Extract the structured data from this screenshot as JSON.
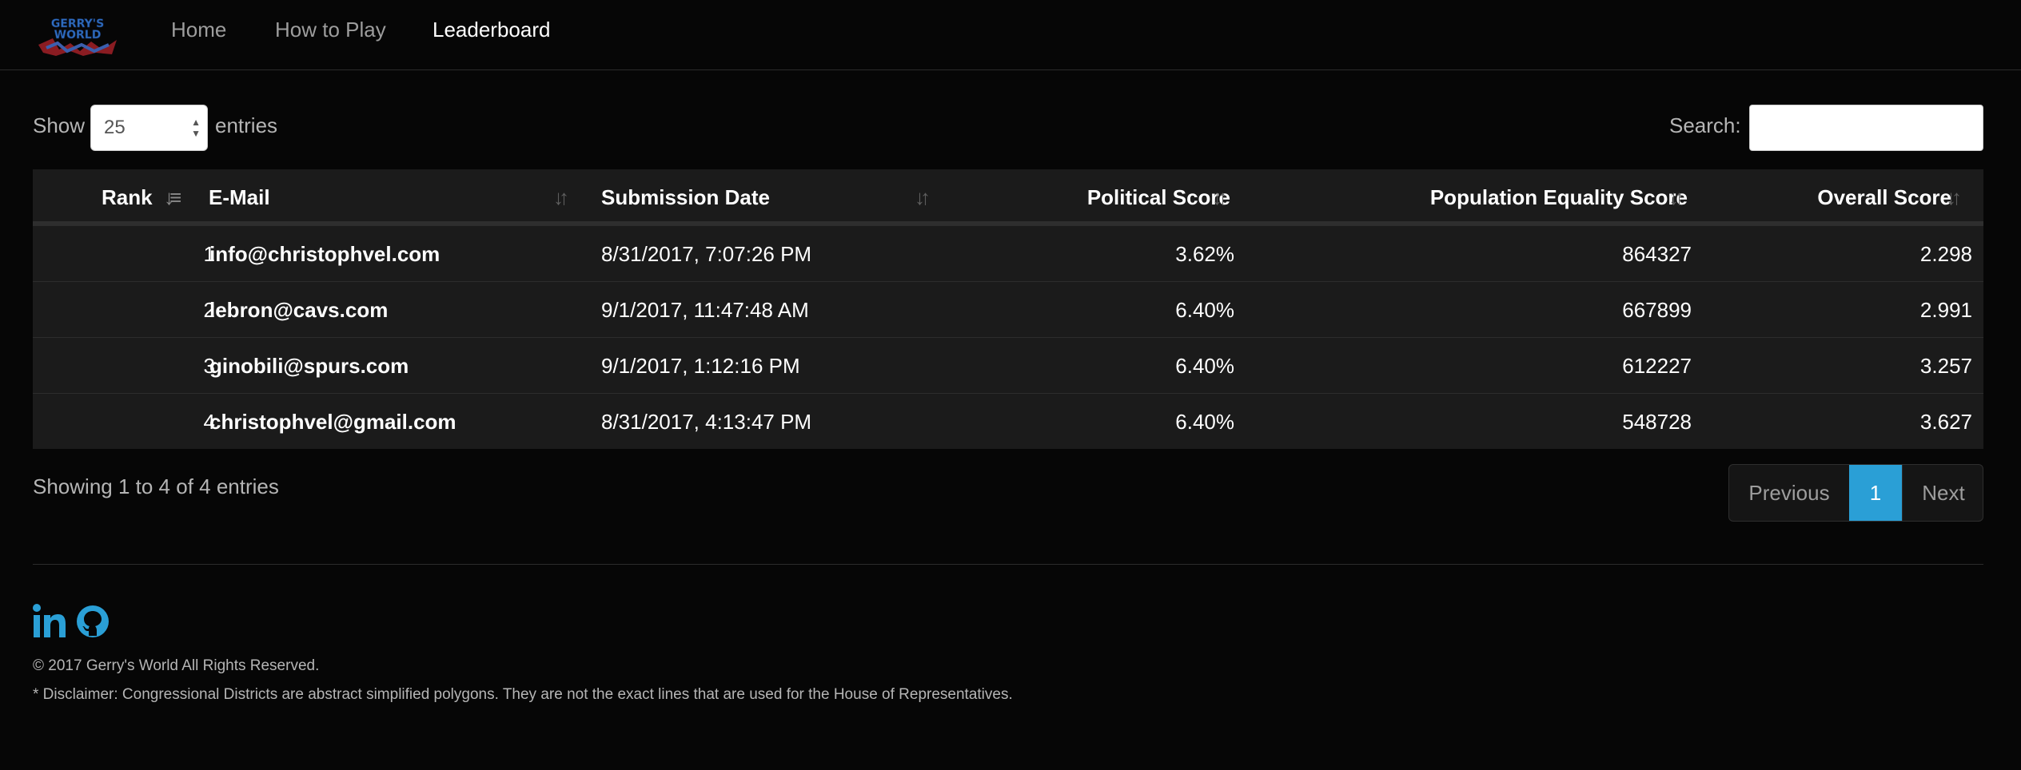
{
  "nav": {
    "logo_text_line1": "GERRY'S",
    "logo_text_line2": "WORLD",
    "links": [
      "Home",
      "How to Play",
      "Leaderboard"
    ],
    "active": "Leaderboard"
  },
  "controls": {
    "show_label": "Show",
    "page_length": "25",
    "entries_label": "entries",
    "search_label": "Search:",
    "search_value": ""
  },
  "table": {
    "columns": [
      "Rank",
      "E-Mail",
      "Submission Date",
      "Political Score",
      "Population Equality Score",
      "Overall Score"
    ],
    "rows": [
      [
        "1",
        "info@christophvel.com",
        "8/31/2017, 7:07:26 PM",
        "3.62%",
        "864327",
        "2.298"
      ],
      [
        "2",
        "lebron@cavs.com",
        "9/1/2017, 11:47:48 AM",
        "6.40%",
        "667899",
        "2.991"
      ],
      [
        "3",
        "ginobili@spurs.com",
        "9/1/2017, 1:12:16 PM",
        "6.40%",
        "612227",
        "3.257"
      ],
      [
        "4",
        "christophvel@gmail.com",
        "8/31/2017, 4:13:47 PM",
        "6.40%",
        "548728",
        "3.627"
      ]
    ],
    "sorted_column": "Rank",
    "sort_direction": "ascending"
  },
  "table_info": "Showing 1 to 4 of 4 entries",
  "pagination": {
    "previous": "Previous",
    "current_page": "1",
    "next": "Next"
  },
  "footer": {
    "social_icons": [
      "linkedin-icon",
      "github-icon"
    ],
    "copyright": "© 2017 Gerry's World All Rights Reserved.",
    "disclaimer": "* Disclaimer: Congressional Districts are abstract simplified polygons. They are not the exact lines that are used for the House of Representatives."
  },
  "colors": {
    "background": "#060606",
    "table_bg": "#1b1b1b",
    "accent": "#2a9fd6",
    "muted_text": "#b5b5b5"
  }
}
